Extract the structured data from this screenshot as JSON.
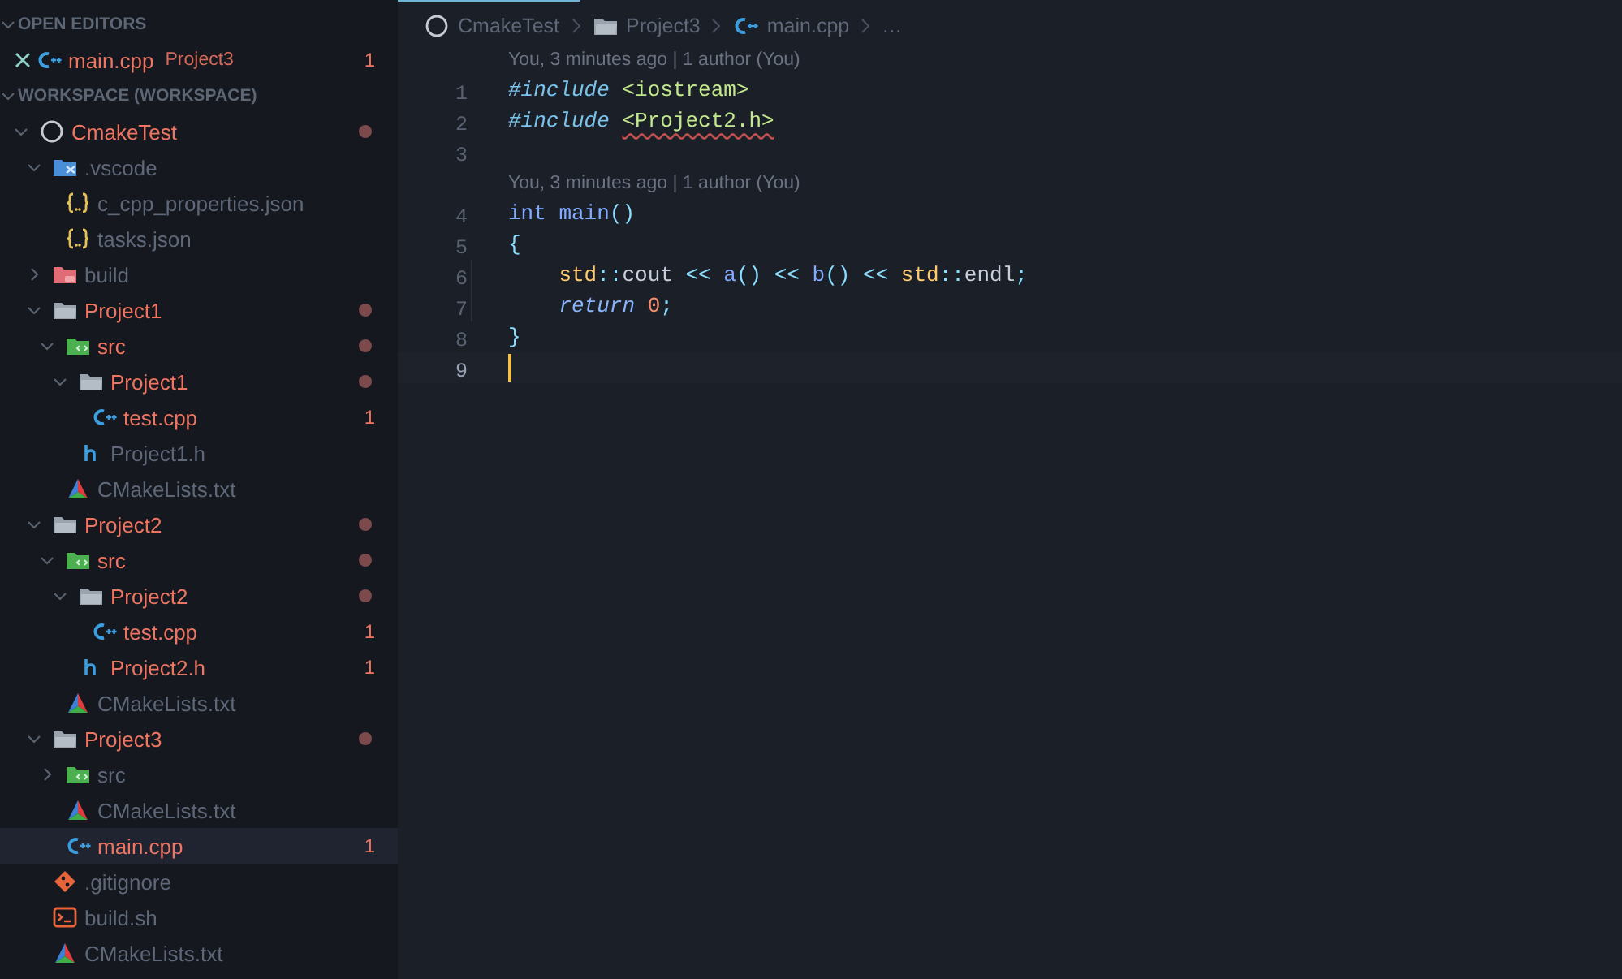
{
  "open_editors": {
    "title": "OPEN EDITORS",
    "expanded": true,
    "items": [
      {
        "name": "main.cpp",
        "description": "Project3",
        "kind": "cpp",
        "modified": true,
        "problems": "1"
      }
    ]
  },
  "workspace": {
    "title": "WORKSPACE (WORKSPACE)",
    "expanded": true,
    "tree": [
      {
        "name": "CmakeTest",
        "kind": "root",
        "expanded": true,
        "modified": true,
        "dot": true,
        "selected": false,
        "children": [
          {
            "name": ".vscode",
            "kind": "vscode",
            "expanded": true,
            "modified": false,
            "dot": false,
            "selected": false,
            "children": [
              {
                "name": "c_cpp_properties.json",
                "kind": "json",
                "modified": false,
                "dot": false,
                "selected": false
              },
              {
                "name": "tasks.json",
                "kind": "json",
                "modified": false,
                "dot": false,
                "selected": false
              }
            ]
          },
          {
            "name": "build",
            "kind": "build",
            "expanded": false,
            "modified": false,
            "dot": false,
            "selected": false
          },
          {
            "name": "Project1",
            "kind": "folder",
            "expanded": true,
            "modified": true,
            "dot": true,
            "selected": false,
            "children": [
              {
                "name": "src",
                "kind": "src",
                "expanded": true,
                "modified": true,
                "dot": true,
                "selected": false,
                "children": [
                  {
                    "name": "Project1",
                    "kind": "folder",
                    "expanded": true,
                    "modified": true,
                    "dot": true,
                    "selected": false,
                    "children": [
                      {
                        "name": "test.cpp",
                        "kind": "cpp",
                        "modified": true,
                        "dot": false,
                        "problems": "1",
                        "selected": false
                      }
                    ]
                  },
                  {
                    "name": "Project1.h",
                    "kind": "h",
                    "modified": false,
                    "dot": false,
                    "selected": false
                  }
                ]
              },
              {
                "name": "CMakeLists.txt",
                "kind": "cmake",
                "modified": false,
                "dot": false,
                "selected": false
              }
            ]
          },
          {
            "name": "Project2",
            "kind": "folder",
            "expanded": true,
            "modified": true,
            "dot": true,
            "selected": false,
            "children": [
              {
                "name": "src",
                "kind": "src",
                "expanded": true,
                "modified": true,
                "dot": true,
                "selected": false,
                "children": [
                  {
                    "name": "Project2",
                    "kind": "folder",
                    "expanded": true,
                    "modified": true,
                    "dot": true,
                    "selected": false,
                    "children": [
                      {
                        "name": "test.cpp",
                        "kind": "cpp",
                        "modified": true,
                        "dot": false,
                        "problems": "1",
                        "selected": false
                      }
                    ]
                  },
                  {
                    "name": "Project2.h",
                    "kind": "h",
                    "modified": true,
                    "dot": false,
                    "problems": "1",
                    "selected": false
                  }
                ]
              },
              {
                "name": "CMakeLists.txt",
                "kind": "cmake",
                "modified": false,
                "dot": false,
                "selected": false
              }
            ]
          },
          {
            "name": "Project3",
            "kind": "folder",
            "expanded": true,
            "modified": true,
            "dot": true,
            "selected": false,
            "children": [
              {
                "name": "src",
                "kind": "src",
                "expanded": false,
                "modified": false,
                "dot": false,
                "selected": false
              },
              {
                "name": "CMakeLists.txt",
                "kind": "cmake",
                "modified": false,
                "dot": false,
                "selected": false
              },
              {
                "name": "main.cpp",
                "kind": "cpp",
                "modified": true,
                "dot": false,
                "problems": "1",
                "selected": true
              }
            ]
          },
          {
            "name": ".gitignore",
            "kind": "git",
            "modified": false,
            "dot": false,
            "selected": false
          },
          {
            "name": "build.sh",
            "kind": "shell",
            "modified": false,
            "dot": false,
            "selected": false
          },
          {
            "name": "CMakeLists.txt",
            "kind": "cmake",
            "modified": false,
            "dot": false,
            "selected": false
          }
        ]
      }
    ]
  },
  "editor": {
    "breadcrumbs": [
      {
        "label": "CmakeTest",
        "kind": "root"
      },
      {
        "label": "Project3",
        "kind": "folder"
      },
      {
        "label": "main.cpp",
        "kind": "cpp"
      },
      {
        "label": "…",
        "kind": "more"
      }
    ],
    "lines": [
      {
        "number": "1",
        "codelens": "You, 3 minutes ago | 1 author (You)",
        "guide": false,
        "current": false,
        "tokens": [
          {
            "t": "#include",
            "kind": "directive"
          },
          {
            "t": " <iostream>",
            "kind": "include"
          }
        ]
      },
      {
        "number": "2",
        "guide": false,
        "current": false,
        "tokens": [
          {
            "t": "#include ",
            "kind": "directive"
          },
          {
            "t": "<Project2.h>",
            "kind": "include",
            "error": true
          }
        ]
      },
      {
        "number": "3",
        "guide": false,
        "current": false
      },
      {
        "number": "4",
        "codelens": "You, 3 minutes ago | 1 author (You)",
        "guide": false,
        "current": false,
        "tokens": [
          {
            "t": "int",
            "kind": "keyword"
          },
          {
            "t": " main",
            "kind": "function"
          },
          {
            "t": "()",
            "kind": "punct"
          }
        ]
      },
      {
        "number": "5",
        "guide": false,
        "current": false,
        "tokens": [
          {
            "t": "{",
            "kind": "punct"
          }
        ]
      },
      {
        "number": "6",
        "guide": true,
        "current": false,
        "tokens": [
          {
            "t": "    std",
            "kind": "namespace"
          },
          {
            "t": "::",
            "kind": "punct"
          },
          {
            "t": "cout",
            "kind": "plain"
          },
          {
            "t": " <<",
            "kind": "punct"
          },
          {
            "t": " a",
            "kind": "function"
          },
          {
            "t": "()",
            "kind": "punct"
          },
          {
            "t": " <<",
            "kind": "punct"
          },
          {
            "t": " b",
            "kind": "function"
          },
          {
            "t": "()",
            "kind": "punct"
          },
          {
            "t": " <<",
            "kind": "punct"
          },
          {
            "t": " std",
            "kind": "namespace"
          },
          {
            "t": "::",
            "kind": "punct"
          },
          {
            "t": "endl",
            "kind": "plain"
          },
          {
            "t": ";",
            "kind": "punct"
          }
        ]
      },
      {
        "number": "7",
        "guide": true,
        "current": false,
        "tokens": [
          {
            "t": "    return",
            "kind": "control"
          },
          {
            "t": " 0",
            "kind": "number"
          },
          {
            "t": ";",
            "kind": "punct"
          }
        ]
      },
      {
        "number": "8",
        "guide": false,
        "current": false,
        "tokens": [
          {
            "t": "}",
            "kind": "punct"
          }
        ]
      },
      {
        "number": "9",
        "guide": false,
        "current": true
      }
    ]
  }
}
